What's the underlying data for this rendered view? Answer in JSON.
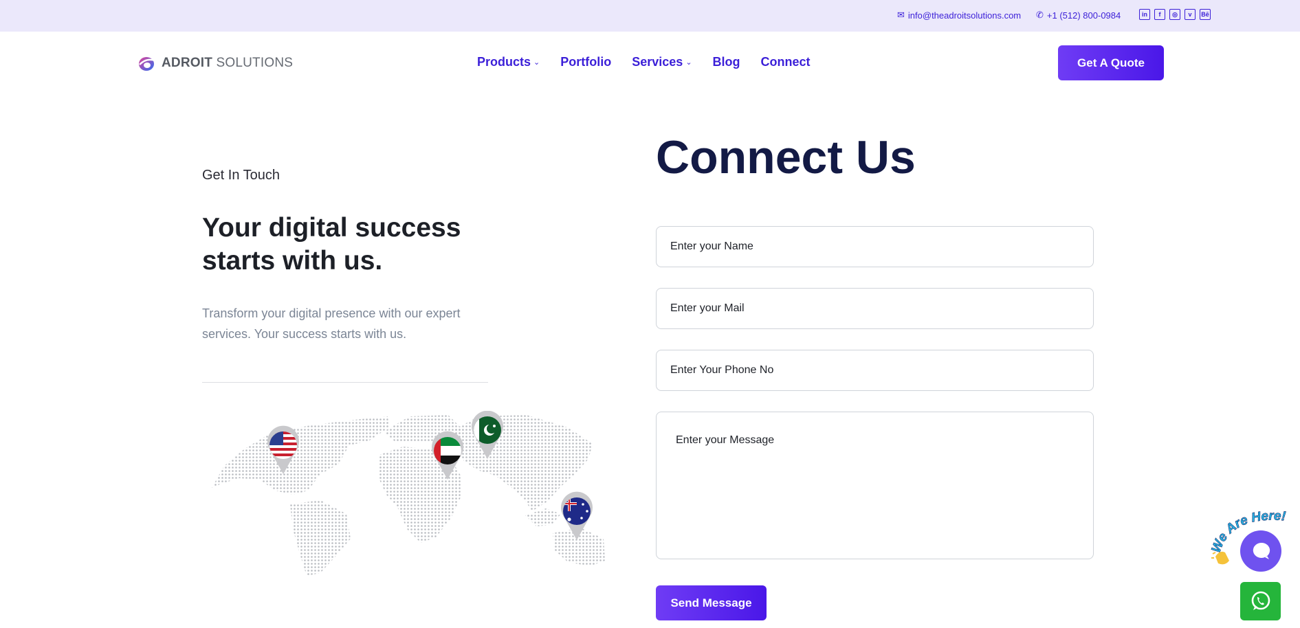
{
  "topbar": {
    "email": "info@theadroitsolutions.com",
    "phone": "+1 (512) 800-0984",
    "socials": [
      "linkedin-icon",
      "facebook-icon",
      "instagram-icon",
      "vimeo-icon",
      "behance-icon"
    ]
  },
  "header": {
    "logo_bold": "ADROIT",
    "logo_light": " SOLUTIONS",
    "nav": {
      "products": "Products",
      "portfolio": "Portfolio",
      "services": "Services",
      "blog": "Blog",
      "connect": "Connect"
    },
    "quote_button": "Get A Quote"
  },
  "intro": {
    "eyebrow": "Get In Touch",
    "headline": "Your digital success starts with us.",
    "lead": "Transform your digital presence with our expert services. Your success starts with us.",
    "map_flags": [
      "us-flag",
      "uae-flag",
      "pakistan-flag",
      "australia-flag"
    ]
  },
  "form": {
    "title": "Connect Us",
    "name_placeholder": "Enter your Name",
    "mail_placeholder": "Enter your Mail",
    "phone_placeholder": "Enter Your Phone No",
    "message_placeholder": "Enter your Message",
    "send_button": "Send Message"
  },
  "widgets": {
    "badge_text": "We Are Here!"
  },
  "colors": {
    "accent": "#4a17e8",
    "topbar_bg": "#ebe8fb",
    "title": "#131a45",
    "whatsapp": "#25b53b"
  }
}
